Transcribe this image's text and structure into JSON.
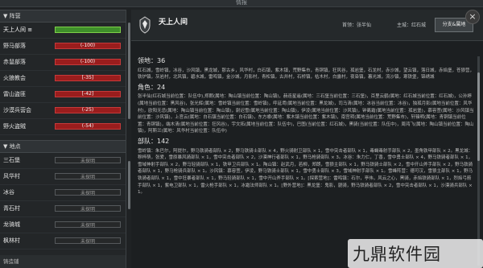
{
  "window_title": "情报",
  "close_label": "×",
  "left": {
    "section1": "▼ 阵营",
    "factions": [
      {
        "name": "天上人间 ≡",
        "value": "",
        "style": "green",
        "selected": true
      },
      {
        "name": "野马部落",
        "value": "(-100)",
        "style": "red"
      },
      {
        "name": "赤鼠部落",
        "value": "(-100)",
        "style": "red"
      },
      {
        "name": "火狼教会",
        "value": "[-35]",
        "style": "red"
      },
      {
        "name": "雷山盗匪",
        "value": "[-42]",
        "style": "red"
      },
      {
        "name": "沙漠兵营会",
        "value": "(-25)",
        "style": "red"
      },
      {
        "name": "野火盗贼",
        "value": "(-54)",
        "style": "red"
      }
    ],
    "section2": "▼ 地点",
    "locations": [
      {
        "name": "三石堡",
        "value": "未探明"
      },
      {
        "name": "风华村",
        "value": "未探明"
      },
      {
        "name": "冰谷",
        "value": "未探明"
      },
      {
        "name": "青石村",
        "value": "未探明"
      },
      {
        "name": "龙骑城",
        "value": "未探明"
      },
      {
        "name": "枫林村",
        "value": "未探明"
      }
    ],
    "bottom_tab": "铸造铺"
  },
  "header": {
    "title": "天上人间",
    "subtitle": "首领：张半仙",
    "leader": "首领：张半仙",
    "city": "主城：红石城",
    "join_button": "分支&属地"
  },
  "content": {
    "territory_title": "领地：36",
    "territory_text": "红石城，雪岭镇，冰谷，沙风镇，黑龙城，那古乡，风华村，白石镇，紫木镇，荒野集市，青铜镇，狂风谷，孤岩堡，石龙村，赤沙城，望云镇，落日城，赤焰堡，苍狼营，铁炉镇，灰岩村，北风镇，碧水城，雷鸣镇，金沙城，月影村，青松镇，古井村，石桥镇，枯木村，白露村，夜枭镇，暮光城，流沙镇，寒铁堡，锦绣城",
    "characters_title": "角色：24",
    "characters_text": "张半仙(红石城当前位置：队伍中),郑朗(属地：陶山镇当前位置：陶山镇)，赫连星遥(属地：三石堡当前位置：三石堡)，百里云鹤(属地：红石城当前位置：红石城)，公孙婷(属地当前位置：黑风谷)，张光辉(属地：雪岭镇当前位置：雪岭镇)，呼延鸢(属地当前位置：黑龙城)，司马清(属地：冰谷当前位置：冰谷)，独孤月影(属地当前位置：风华村)，欧阳无忌(属地：陶山镇当前位置：陶山镇)，尉迟雪(属地当前位置：陶山镇)，伊凌(属地当前位置：沙风镇)，钟离霜(属地当前位置：孤岩堡)，慕容萱(属地：沙风镇当前位置：沙风镇)，上官云(属地：白石镇当前位置：白石镇)，东方睿(属地：紫木镇当前位置：紫木镇)，南宫玥(属地当前位置：荒野集市)，轩辕明(属地：青铜镇当前位置：青铜镇)，端木清(属地当前位置：狂风谷)，宇文拓(属地当前位置：队伍中)，巴图(当前位置：红石城)，黑骑(当前位置：队伍中)，周鸿飞(属地：陶山镇当前位置：陶山镇)，阿斯兰(属地：风华村当前位置：队伍中)",
    "troops_title": "部队：142",
    "troops_text": "雪岭镇：朱巴尔，阿提尔，野马铁骑者部队 × 2，野马铁骑士部队 × 4，野火骑射卫部队 × 1，雪中突击者部队 × 1，毒蝎毒射手部队 × 2，墨角铁甲部队 × 2。黑龙城：穆梓萌，张爱，雪原暴风骑部队 × 1，雪中突击者部队 × 2，沙漠神行者部队 × 1，野马枪骑部队 × 3。冰谷：朱力仁，丁香，雪中勇士部队 × 4，野马铁骑者部队 × 1，雪域神射手部队 × 2，野马轻骑部队 × 1，铁甲卫兵部队 × 1。陶山镇：赵武月，若柳，郑朗，雪狼主部队 × 1，野马铁骑士部队 × 2，雪中开山斧手部队 × 2，野马铁骑者部队 × 1，野马枪骑兵部队 × 1。沙风镇：慕容萱，伊凌，野马铁骑士部队 × 1，雪中勇士部队 × 3，雪域神射手部队 × 1。雪峰阵营：德可汉，雪狼主部队 × 1，野马铁骑者部队 × 1，雪中狂暴者部队 × 1，野马轻骑部队 × 1，雪中开山斧手部队 × 1。[探索营地]：雷鸣镇：石尔，亭伟，风云之心，黑骑，赤焰铁骑部队 × 1，烈焰弓箭手部队 × 1，紫电卫部队 × 1，雷火枪手部队 × 1，冰霜法师部队 × 1。[野外营地]：黑龙堡：鬼影，骁骑，野马铁骑者部队 × 2，雪中突击者部队 × 1，沙漠骑兵部队 × 1。"
  },
  "watermark": "九鼎软件园"
}
